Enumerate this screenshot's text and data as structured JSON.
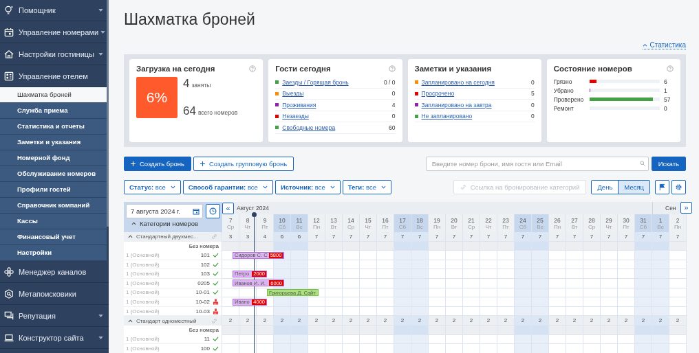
{
  "sidebar": {
    "items": [
      {
        "label": "Помощник",
        "collapsible": true
      },
      {
        "label": "Управление номерами",
        "collapsible": true
      },
      {
        "label": "Настройки гостиницы",
        "collapsible": true
      },
      {
        "label": "Управление отелем",
        "collapsible": false,
        "children": [
          {
            "label": "Шахматка броней",
            "selected": true
          },
          {
            "label": "Служба приема",
            "selected": false
          },
          {
            "label": "Статистика и отчеты",
            "selected": false
          },
          {
            "label": "Заметки и указания",
            "selected": false
          },
          {
            "label": "Номерной фонд",
            "selected": false
          },
          {
            "label": "Обслуживание номеров",
            "selected": false
          },
          {
            "label": "Профили гостей",
            "selected": false
          },
          {
            "label": "Справочник компаний",
            "selected": false
          },
          {
            "label": "Кассы",
            "selected": false
          },
          {
            "label": "Финансовый учет",
            "selected": false
          },
          {
            "label": "Настройки",
            "selected": false
          }
        ]
      },
      {
        "label": "Менеджер каналов",
        "collapsible": false
      },
      {
        "label": "Метапоисковики",
        "collapsible": false
      },
      {
        "label": "Репутация",
        "collapsible": true
      },
      {
        "label": "Конструктор сайта",
        "collapsible": true
      }
    ]
  },
  "page": {
    "title": "Шахматка броней",
    "stats_link": "Статистика"
  },
  "cards": [
    {
      "kind": "load",
      "title": "Загрузка на сегодня",
      "percent": "6%",
      "occupied": "4",
      "occupied_label": "заняты",
      "total": "64",
      "total_label": "всего номеров"
    },
    {
      "kind": "list",
      "title": "Гости сегодня",
      "help": true,
      "items": [
        {
          "label": "Заезды / Горящая бронь",
          "value": "0 / 0",
          "color": "#43a047"
        },
        {
          "label": "Выезды",
          "value": "0",
          "color": "#fb8c00"
        },
        {
          "label": "Проживания",
          "value": "4",
          "color": "#8e24aa"
        },
        {
          "label": "Незаезды",
          "value": "0",
          "color": "#e50000"
        },
        {
          "label": "Свободные номера",
          "value": "60",
          "color": "#43a047"
        }
      ]
    },
    {
      "kind": "list",
      "title": "Заметки и указания",
      "help": false,
      "items": [
        {
          "label": "Запланировано на сегодня",
          "value": "0",
          "color": "#fb8c00"
        },
        {
          "label": "Просрочено",
          "value": "5",
          "color": "#e50000"
        },
        {
          "label": "Запланировано на завтра",
          "value": "0",
          "color": "#8e24aa"
        },
        {
          "label": "Не запланировано",
          "value": "0",
          "color": "#43a047"
        }
      ]
    },
    {
      "kind": "bars",
      "title": "Состояние номеров",
      "items": [
        {
          "label": "Грязно",
          "value": "6",
          "level": 0.1,
          "color": "#e50000"
        },
        {
          "label": "Убрано",
          "value": "1",
          "level": 0.015,
          "color": "#8e24aa"
        },
        {
          "label": "Проверено",
          "value": "57",
          "level": 0.9,
          "color": "#43a047"
        },
        {
          "label": "Ремонт",
          "value": "0"
        }
      ]
    }
  ],
  "actions": {
    "create": "Создать бронь",
    "create_group": "Создать групповую бронь",
    "search_placeholder": "Введите номер брони, имя гостя или Email",
    "search_button": "Искать"
  },
  "filters": [
    "**Статус:** все",
    "**Способ гарантии:** все",
    "**Источник:** все",
    "**Теги:** все"
  ],
  "booking_link": {
    "label": "Ссылка на бронирование категорий",
    "disabled": true
  },
  "view_modes": [
    {
      "label": "День",
      "selected": false
    },
    {
      "label": "Месяц",
      "selected": true
    }
  ],
  "grid": {
    "date": "7 августа 2024 г.",
    "categories_label": "Категории номеров",
    "prev_button": "«",
    "next_button": "»",
    "months": [
      "Август 2024",
      "Сен"
    ],
    "days": [
      {
        "day": "7",
        "weekday": "Ср",
        "weekend": false
      },
      {
        "day": "8",
        "weekday": "Чт",
        "weekend": false,
        "today": true
      },
      {
        "day": "9",
        "weekday": "Пт",
        "weekend": false
      },
      {
        "day": "10",
        "weekday": "Сб",
        "weekend": true
      },
      {
        "day": "11",
        "weekday": "Вс",
        "weekend": true
      },
      {
        "day": "12",
        "weekday": "Пн",
        "weekend": false
      },
      {
        "day": "13",
        "weekday": "Вт",
        "weekend": false
      },
      {
        "day": "14",
        "weekday": "Ср",
        "weekend": false
      },
      {
        "day": "15",
        "weekday": "Чт",
        "weekend": false
      },
      {
        "day": "16",
        "weekday": "Пт",
        "weekend": false
      },
      {
        "day": "17",
        "weekday": "Сб",
        "weekend": true
      },
      {
        "day": "18",
        "weekday": "Вс",
        "weekend": true
      },
      {
        "day": "19",
        "weekday": "Пн",
        "weekend": false
      },
      {
        "day": "20",
        "weekday": "Вт",
        "weekend": false
      },
      {
        "day": "21",
        "weekday": "Ср",
        "weekend": false
      },
      {
        "day": "22",
        "weekday": "Чт",
        "weekend": false
      },
      {
        "day": "23",
        "weekday": "Пт",
        "weekend": false
      },
      {
        "day": "24",
        "weekday": "Сб",
        "weekend": true
      },
      {
        "day": "25",
        "weekday": "Вс",
        "weekend": true
      },
      {
        "day": "26",
        "weekday": "Пн",
        "weekend": false
      },
      {
        "day": "27",
        "weekday": "Вт",
        "weekend": false
      },
      {
        "day": "28",
        "weekday": "Ср",
        "weekend": false
      },
      {
        "day": "29",
        "weekday": "Чт",
        "weekend": false
      },
      {
        "day": "30",
        "weekday": "Пт",
        "weekend": false
      },
      {
        "day": "31",
        "weekday": "Сб",
        "weekend": true
      },
      {
        "day": "1",
        "weekday": "Вс",
        "weekend": true,
        "month_start": true
      },
      {
        "day": "2",
        "weekday": "Пн",
        "weekend": false
      }
    ],
    "categories": [
      {
        "name": "Стандартный двухмес...",
        "expanded": true,
        "counts": [
          "3",
          "3",
          "4",
          "6",
          "6",
          "7",
          "7",
          "7",
          "7",
          "7",
          "7",
          "7",
          "7",
          "7",
          "7",
          "7",
          "7",
          "7",
          "7",
          "7",
          "7",
          "7",
          "7",
          "7",
          "7",
          "7",
          "7"
        ],
        "unassigned": "Без номера",
        "rooms": [
          {
            "rate": "1 (Основной)",
            "room": "101",
            "dirty": false,
            "slots": [
              {
                "kind": "arrival",
                "guest": "Сидоров С. С.",
                "price": "5800",
                "color": "#ddb4f2",
                "flag": true
              },
              {
                "kind": "stay"
              },
              {
                "kind": "stay"
              }
            ]
          },
          {
            "rate": "1 (Основной)",
            "room": "102",
            "dirty": false
          },
          {
            "rate": "1 (Основной)",
            "room": "103",
            "dirty": false,
            "slots": [
              {
                "kind": "arrival",
                "guest": "Петро",
                "price": "2000",
                "color": "#ddb4f2",
                "flag": false
              },
              {
                "kind": "stay"
              }
            ]
          },
          {
            "rate": "1 (Основной)",
            "room": "0205",
            "dirty": false,
            "slots": [
              {
                "kind": "arrival",
                "guest": "Иванов И. И.",
                "price": "6000",
                "color": "#ddb4f2",
                "flag": false
              },
              {
                "kind": "stay"
              },
              {
                "kind": "stay"
              }
            ]
          },
          {
            "rate": "1 (Основной)",
            "room": "10-01",
            "dirty": false,
            "slots": [
              {
                "kind": "free"
              },
              {
                "kind": "free"
              },
              {
                "kind": "arrival",
                "guest": "Григорьева Д. Сайт",
                "color": "#a9e27a",
                "flag": false
              },
              {
                "kind": "stay"
              },
              {
                "kind": "stay"
              }
            ]
          },
          {
            "rate": "1 (Основной)",
            "room": "10-02",
            "dirty": true,
            "slots": [
              {
                "kind": "arrival",
                "guest": "Ивано",
                "price": "4000",
                "color": "#ddb4f2",
                "flag": false
              },
              {
                "kind": "stay"
              }
            ]
          },
          {
            "rate": "1 (Основной)",
            "room": "10-03",
            "dirty": true
          }
        ]
      },
      {
        "name": "Стандарт одноместный",
        "expanded": true,
        "counts": [
          "2",
          "2",
          "2",
          "2",
          "2",
          "2",
          "2",
          "2",
          "2",
          "2",
          "2",
          "2",
          "2",
          "2",
          "2",
          "2",
          "2",
          "2",
          "2",
          "2",
          "2",
          "2",
          "2",
          "2",
          "2",
          "2",
          "2"
        ],
        "unassigned": "Без номера",
        "rooms": [
          {
            "rate": "1 (Основной)",
            "room": "11",
            "dirty": false
          },
          {
            "rate": "1 (Основной)",
            "room": "100",
            "dirty": false
          }
        ]
      }
    ]
  }
}
